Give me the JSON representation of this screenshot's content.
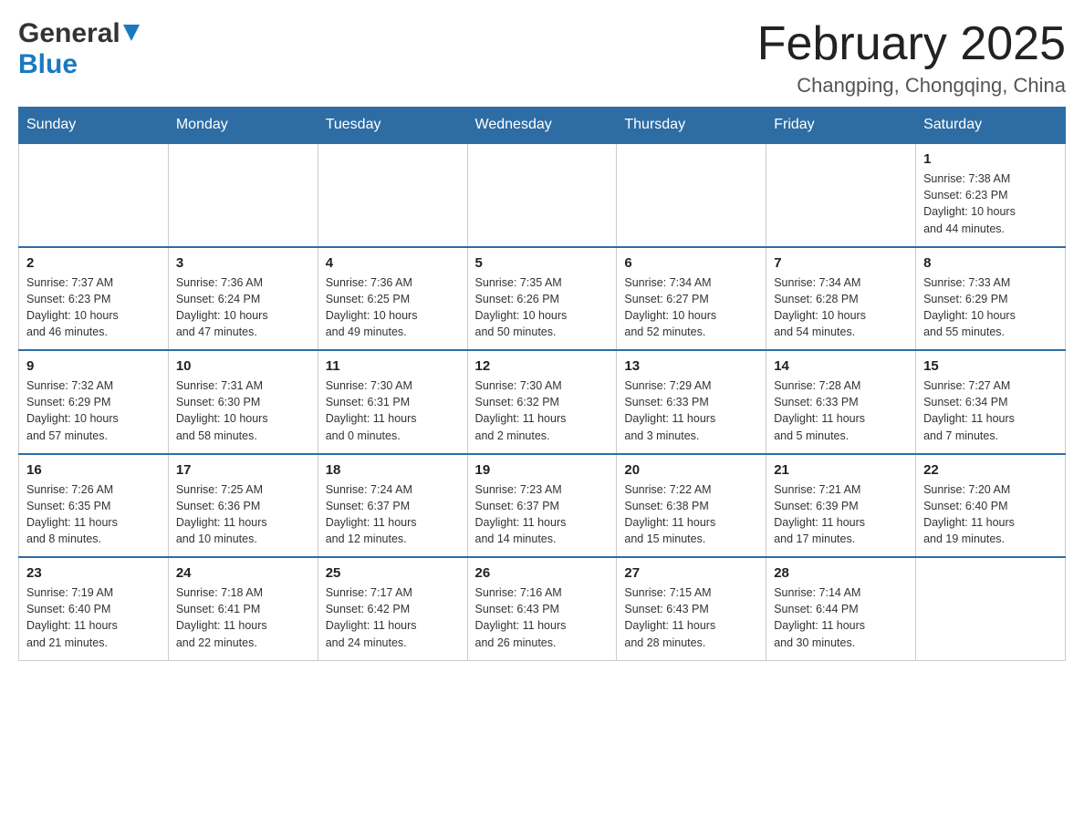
{
  "logo": {
    "general": "General",
    "blue": "Blue"
  },
  "header": {
    "month": "February 2025",
    "location": "Changping, Chongqing, China"
  },
  "weekdays": [
    "Sunday",
    "Monday",
    "Tuesday",
    "Wednesday",
    "Thursday",
    "Friday",
    "Saturday"
  ],
  "weeks": [
    {
      "days": [
        {
          "number": "",
          "info": ""
        },
        {
          "number": "",
          "info": ""
        },
        {
          "number": "",
          "info": ""
        },
        {
          "number": "",
          "info": ""
        },
        {
          "number": "",
          "info": ""
        },
        {
          "number": "",
          "info": ""
        },
        {
          "number": "1",
          "info": "Sunrise: 7:38 AM\nSunset: 6:23 PM\nDaylight: 10 hours\nand 44 minutes."
        }
      ]
    },
    {
      "days": [
        {
          "number": "2",
          "info": "Sunrise: 7:37 AM\nSunset: 6:23 PM\nDaylight: 10 hours\nand 46 minutes."
        },
        {
          "number": "3",
          "info": "Sunrise: 7:36 AM\nSunset: 6:24 PM\nDaylight: 10 hours\nand 47 minutes."
        },
        {
          "number": "4",
          "info": "Sunrise: 7:36 AM\nSunset: 6:25 PM\nDaylight: 10 hours\nand 49 minutes."
        },
        {
          "number": "5",
          "info": "Sunrise: 7:35 AM\nSunset: 6:26 PM\nDaylight: 10 hours\nand 50 minutes."
        },
        {
          "number": "6",
          "info": "Sunrise: 7:34 AM\nSunset: 6:27 PM\nDaylight: 10 hours\nand 52 minutes."
        },
        {
          "number": "7",
          "info": "Sunrise: 7:34 AM\nSunset: 6:28 PM\nDaylight: 10 hours\nand 54 minutes."
        },
        {
          "number": "8",
          "info": "Sunrise: 7:33 AM\nSunset: 6:29 PM\nDaylight: 10 hours\nand 55 minutes."
        }
      ]
    },
    {
      "days": [
        {
          "number": "9",
          "info": "Sunrise: 7:32 AM\nSunset: 6:29 PM\nDaylight: 10 hours\nand 57 minutes."
        },
        {
          "number": "10",
          "info": "Sunrise: 7:31 AM\nSunset: 6:30 PM\nDaylight: 10 hours\nand 58 minutes."
        },
        {
          "number": "11",
          "info": "Sunrise: 7:30 AM\nSunset: 6:31 PM\nDaylight: 11 hours\nand 0 minutes."
        },
        {
          "number": "12",
          "info": "Sunrise: 7:30 AM\nSunset: 6:32 PM\nDaylight: 11 hours\nand 2 minutes."
        },
        {
          "number": "13",
          "info": "Sunrise: 7:29 AM\nSunset: 6:33 PM\nDaylight: 11 hours\nand 3 minutes."
        },
        {
          "number": "14",
          "info": "Sunrise: 7:28 AM\nSunset: 6:33 PM\nDaylight: 11 hours\nand 5 minutes."
        },
        {
          "number": "15",
          "info": "Sunrise: 7:27 AM\nSunset: 6:34 PM\nDaylight: 11 hours\nand 7 minutes."
        }
      ]
    },
    {
      "days": [
        {
          "number": "16",
          "info": "Sunrise: 7:26 AM\nSunset: 6:35 PM\nDaylight: 11 hours\nand 8 minutes."
        },
        {
          "number": "17",
          "info": "Sunrise: 7:25 AM\nSunset: 6:36 PM\nDaylight: 11 hours\nand 10 minutes."
        },
        {
          "number": "18",
          "info": "Sunrise: 7:24 AM\nSunset: 6:37 PM\nDaylight: 11 hours\nand 12 minutes."
        },
        {
          "number": "19",
          "info": "Sunrise: 7:23 AM\nSunset: 6:37 PM\nDaylight: 11 hours\nand 14 minutes."
        },
        {
          "number": "20",
          "info": "Sunrise: 7:22 AM\nSunset: 6:38 PM\nDaylight: 11 hours\nand 15 minutes."
        },
        {
          "number": "21",
          "info": "Sunrise: 7:21 AM\nSunset: 6:39 PM\nDaylight: 11 hours\nand 17 minutes."
        },
        {
          "number": "22",
          "info": "Sunrise: 7:20 AM\nSunset: 6:40 PM\nDaylight: 11 hours\nand 19 minutes."
        }
      ]
    },
    {
      "days": [
        {
          "number": "23",
          "info": "Sunrise: 7:19 AM\nSunset: 6:40 PM\nDaylight: 11 hours\nand 21 minutes."
        },
        {
          "number": "24",
          "info": "Sunrise: 7:18 AM\nSunset: 6:41 PM\nDaylight: 11 hours\nand 22 minutes."
        },
        {
          "number": "25",
          "info": "Sunrise: 7:17 AM\nSunset: 6:42 PM\nDaylight: 11 hours\nand 24 minutes."
        },
        {
          "number": "26",
          "info": "Sunrise: 7:16 AM\nSunset: 6:43 PM\nDaylight: 11 hours\nand 26 minutes."
        },
        {
          "number": "27",
          "info": "Sunrise: 7:15 AM\nSunset: 6:43 PM\nDaylight: 11 hours\nand 28 minutes."
        },
        {
          "number": "28",
          "info": "Sunrise: 7:14 AM\nSunset: 6:44 PM\nDaylight: 11 hours\nand 30 minutes."
        },
        {
          "number": "",
          "info": ""
        }
      ]
    }
  ]
}
